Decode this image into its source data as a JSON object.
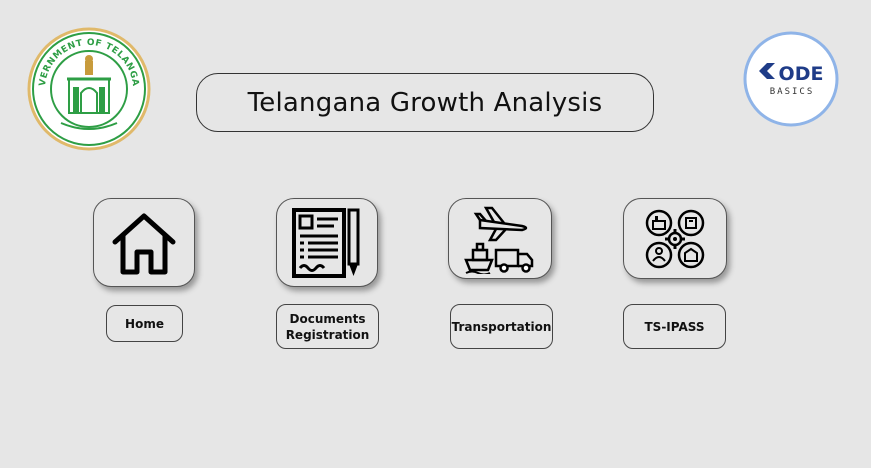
{
  "header": {
    "title": "Telangana Growth Analysis"
  },
  "emblem": {
    "text_ring": "GOVERNMENT OF TELANGANA",
    "color": "#2e9e45"
  },
  "brand_logo": {
    "letters": "ODE",
    "subtext": "BASICS",
    "color": "#1f3c88"
  },
  "nav": [
    {
      "label_line1": "Home",
      "label_line2": "",
      "icon": "house-icon"
    },
    {
      "label_line1": "Documents",
      "label_line2": "Registration",
      "icon": "document-pen-icon"
    },
    {
      "label_line1": "Transportation",
      "label_line2": "",
      "icon": "transport-icon"
    },
    {
      "label_line1": "TS-IPASS",
      "label_line2": "",
      "icon": "industry-gear-icon"
    }
  ]
}
